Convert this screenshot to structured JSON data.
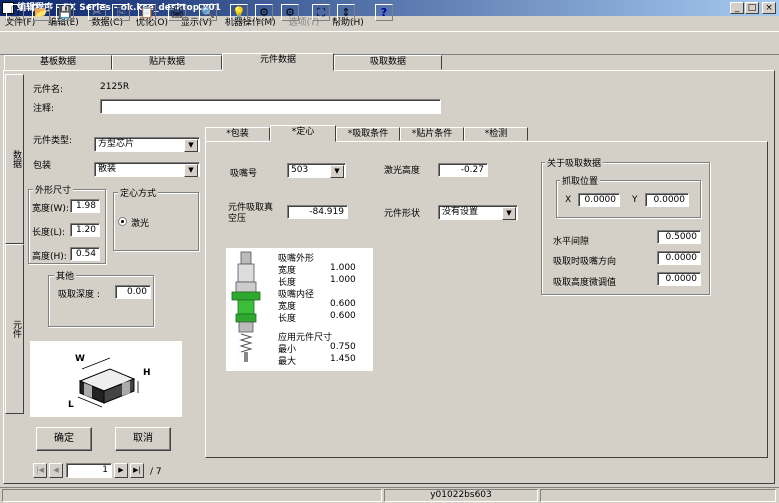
{
  "window": {
    "title": "编辑程序 - FX Series - ok.kse_desktop.x01",
    "min": "_",
    "max": "□",
    "close": "×"
  },
  "menu": [
    "文件(F)",
    "编辑(E)",
    "数据(C)",
    "优化(O)",
    "显示(V)",
    "机器操作(M)",
    "选项(T)",
    "帮助(H)"
  ],
  "menu_disabled": [
    false,
    false,
    false,
    false,
    false,
    false,
    true,
    false
  ],
  "toolbar_glyphs": [
    "🗋",
    "📂",
    "💾",
    "✂",
    "⎘",
    "📋",
    "🖨",
    "🔍",
    "💡",
    "⚙",
    "⚙",
    "⛶",
    "⇕",
    "?"
  ],
  "top_tabs": [
    "基板数据",
    "贴片数据",
    "元件数据",
    "吸取数据"
  ],
  "side_tabs": [
    "数据",
    "元件"
  ],
  "part": {
    "name_label": "元件名:",
    "name_value": "2125R",
    "comment_label": "注释:",
    "comment_value": "",
    "type_label": "元件类型:",
    "type_value": "方型芯片",
    "package_label": "包装",
    "package_value": "散装"
  },
  "outer_size": {
    "title": "外形尺寸",
    "width_label": "宽度(W):",
    "width_value": "1.98",
    "length_label": "长度(L):",
    "length_value": "1.20",
    "height_label": "高度(H):",
    "height_value": "0.54"
  },
  "centering": {
    "title": "定心方式",
    "option": "激光"
  },
  "other": {
    "title": "其他",
    "depth_label": "吸取深度 :",
    "depth_value": "0.00"
  },
  "diagram_labels": {
    "w": "W",
    "h": "H",
    "l": "L"
  },
  "buttons": {
    "ok": "确定",
    "cancel": "取消"
  },
  "nav": {
    "first": "|◀",
    "prev": "◀",
    "next": "▶",
    "last": "▶|",
    "page_value": "1",
    "page_total": "/ 7"
  },
  "part_tabs": [
    "*包装",
    "*定心",
    "*吸取条件",
    "*贴片条件",
    "*检测"
  ],
  "centering_panel": {
    "nozzle_label": "吸嘴号",
    "nozzle_value": "503",
    "laser_height_label": "激光高度",
    "laser_height_value": "-0.27",
    "vacuum_label": "元件吸取真空压",
    "vacuum_value": "-84.919",
    "shape_label": "元件形状",
    "shape_value": "没有设置"
  },
  "nozzle_info": {
    "outer_title": "吸嘴外形",
    "outer_width_label": "宽度",
    "outer_width_value": "1.000",
    "outer_length_label": "长度",
    "outer_length_value": "1.000",
    "inner_title": "吸嘴内径",
    "inner_width_label": "宽度",
    "inner_width_value": "0.600",
    "inner_length_label": "长度",
    "inner_length_value": "0.600",
    "applicable_title": "应用元件尺寸",
    "min_label": "最小",
    "min_value": "0.750",
    "max_label": "最大",
    "max_value": "1.450"
  },
  "pickup_data": {
    "title": "关于吸取数据",
    "position_title": "抓取位置",
    "x_label": "X",
    "x_value": "0.0000",
    "y_label": "Y",
    "y_value": "0.0000",
    "horizontal_label": "水平间隙",
    "horizontal_value": "0.5000",
    "direction_label": "吸取时吸嘴方向",
    "direction_value": "0.0000",
    "height_adjust_label": "吸取高度微调值",
    "height_adjust_value": "0.0000"
  },
  "status": {
    "center": "y01022bs603"
  }
}
